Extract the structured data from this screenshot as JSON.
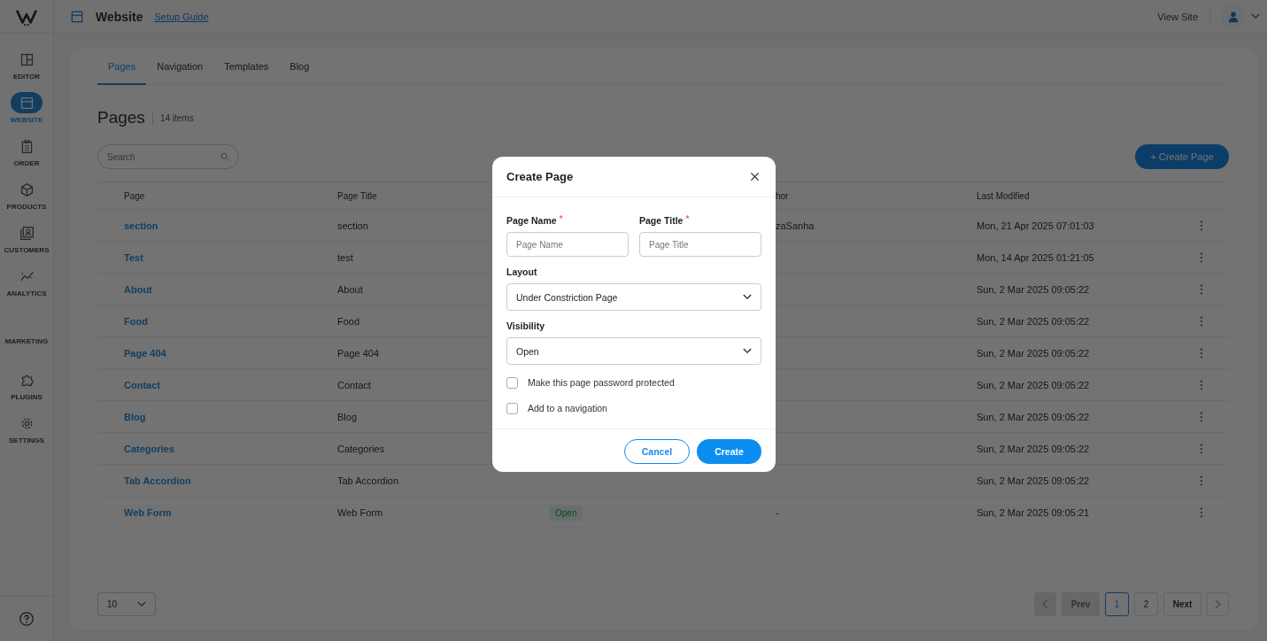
{
  "header": {
    "title": "Website",
    "setup_link": "Setup Guide",
    "view_site": "View Site"
  },
  "sidebar": {
    "items": [
      {
        "kind": "item",
        "label": "EDITOR",
        "selected": false
      },
      {
        "kind": "item",
        "label": "WEBSITE",
        "selected": true
      },
      {
        "kind": "item",
        "label": "ORDER",
        "selected": false
      },
      {
        "kind": "item",
        "label": "PRODUCTS",
        "selected": false
      },
      {
        "kind": "item",
        "label": "CUSTOMERS",
        "selected": false
      },
      {
        "kind": "item",
        "label": "ANALYTICS",
        "selected": false
      },
      {
        "kind": "heading",
        "label": "MARKETING"
      },
      {
        "kind": "item",
        "label": "PLUGINS",
        "selected": false
      },
      {
        "kind": "item",
        "label": "SETTINGS",
        "selected": false
      }
    ]
  },
  "tabs": [
    {
      "label": "Pages",
      "selected": true
    },
    {
      "label": "Navigation",
      "selected": false
    },
    {
      "label": "Templates",
      "selected": false
    },
    {
      "label": "Blog",
      "selected": false
    }
  ],
  "heading": {
    "title": "Pages",
    "count": "14 items"
  },
  "search": {
    "placeholder": "Search"
  },
  "create_button": "+ Create Page",
  "table": {
    "headers": {
      "page": "Page",
      "page_title": "Page Title",
      "author": "hor",
      "last_modified": "Last Modified"
    },
    "rows": [
      {
        "page": "section",
        "page_title": "section",
        "author": "zaSanha",
        "last_modified": "Mon, 21 Apr 2025 07:01:03"
      },
      {
        "page": "Test",
        "page_title": "test",
        "last_modified": "Mon, 14 Apr 2025 01:21:05"
      },
      {
        "page": "About",
        "page_title": "About",
        "last_modified": "Sun, 2 Mar 2025 09:05:22"
      },
      {
        "page": "Food",
        "page_title": "Food",
        "last_modified": "Sun, 2 Mar 2025 09:05:22"
      },
      {
        "page": "Page 404",
        "page_title": "Page 404",
        "last_modified": "Sun, 2 Mar 2025 09:05:22"
      },
      {
        "page": "Contact",
        "page_title": "Contact",
        "last_modified": "Sun, 2 Mar 2025 09:05:22"
      },
      {
        "page": "Blog",
        "page_title": "Blog",
        "last_modified": "Sun, 2 Mar 2025 09:05:22"
      },
      {
        "page": "Categories",
        "page_title": "Categories",
        "last_modified": "Sun, 2 Mar 2025 09:05:22"
      },
      {
        "page": "Tab Accordion",
        "page_title": "Tab Accordion",
        "last_modified": "Sun, 2 Mar 2025 09:05:22"
      },
      {
        "page": "Web Form",
        "page_title": "Web Form",
        "status": "Open",
        "author": "-",
        "last_modified": "Sun, 2 Mar 2025 09:05:21"
      }
    ]
  },
  "page_size": "10",
  "pagination": {
    "prev": {
      "label": "Prev",
      "disabled": true
    },
    "pages": [
      {
        "label": "1",
        "selected": true
      },
      {
        "label": "2",
        "selected": false
      }
    ],
    "next": {
      "label": "Next",
      "disabled": false
    }
  },
  "modal": {
    "title": "Create Page",
    "fields": [
      {
        "label": "Page Name",
        "required_mark": "*",
        "placeholder": "Page Name"
      },
      {
        "label": "Page Title",
        "required_mark": "*",
        "placeholder": "Page Title"
      }
    ],
    "selects": [
      {
        "label": "Layout",
        "value": "Under Constriction Page"
      },
      {
        "label": "Visibility",
        "value": "Open"
      }
    ],
    "checkboxes": [
      {
        "label": "Make this page password protected",
        "checked": false
      },
      {
        "label": "Add to a navigation",
        "checked": false
      }
    ],
    "cancel": "Cancel",
    "create": "Create"
  }
}
